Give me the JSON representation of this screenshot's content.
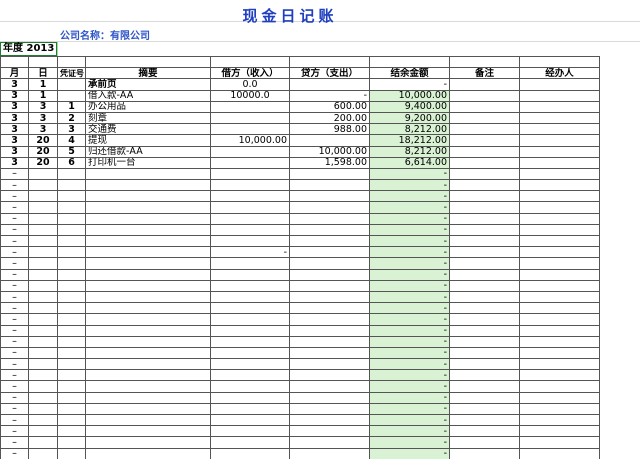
{
  "sheet": {
    "title": "现金日记账",
    "company": "公司名称：有限公司",
    "year_label": "年度",
    "year_value": "2013"
  },
  "headers": [
    "月",
    "日",
    "凭证号",
    "摘要",
    "借方（收入）",
    "贷方（支出）",
    "结余金额",
    "备注",
    "经办人"
  ],
  "rows": [
    {
      "month": "3",
      "day": "1",
      "voucher": "",
      "summary": "承前页",
      "debit": "0.0",
      "credit": "",
      "balance": "-",
      "summary_bold": true,
      "debit_align": "c"
    },
    {
      "month": "3",
      "day": "1",
      "voucher": "",
      "summary": "借入款-AA",
      "debit": "10000.0",
      "credit": "-",
      "balance": "10,000.00",
      "debit_align": "c"
    },
    {
      "month": "3",
      "day": "3",
      "voucher": "1",
      "summary": "办公用品",
      "debit": "",
      "credit": "600.00",
      "balance": "9,400.00"
    },
    {
      "month": "3",
      "day": "3",
      "voucher": "2",
      "summary": "刻章",
      "debit": "",
      "credit": "200.00",
      "balance": "9,200.00"
    },
    {
      "month": "3",
      "day": "3",
      "voucher": "3",
      "summary": "交通费",
      "debit": "",
      "credit": "988.00",
      "balance": "8,212.00"
    },
    {
      "month": "3",
      "day": "20",
      "voucher": "4",
      "summary": "提现",
      "debit": "10,000.00",
      "credit": "",
      "balance": "18,212.00"
    },
    {
      "month": "3",
      "day": "20",
      "voucher": "5",
      "summary": "归还借款-AA",
      "debit": "",
      "credit": "10,000.00",
      "balance": "8,212.00"
    },
    {
      "month": "3",
      "day": "20",
      "voucher": "6",
      "summary": "打印机一台",
      "debit": "",
      "credit": "1,598.00",
      "balance": "6,614.00"
    }
  ],
  "empty_row": {
    "month": "–",
    "balance": "-"
  },
  "empty_rows_special": {
    "7": {
      "debit": "-"
    }
  },
  "empty_row_count": 27,
  "colors": {
    "balance_fill": "#d9f2d4",
    "title": "#1f3fbf",
    "selection": "#1e7b34"
  }
}
